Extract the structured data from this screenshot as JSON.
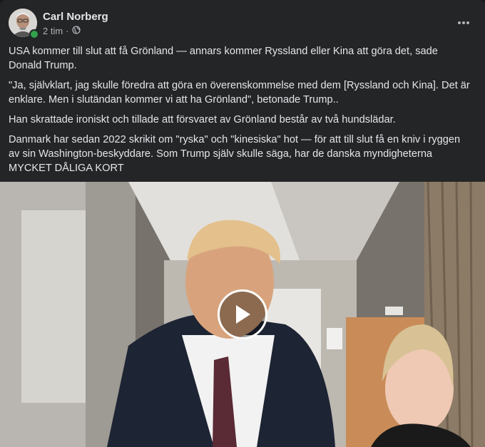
{
  "post": {
    "author": "Carl Norberg",
    "time": "2 tim",
    "privacy_icon": "globe-icon",
    "more_icon": "more-options-icon",
    "paragraphs": [
      "USA kommer till slut att få Grönland — annars kommer Ryssland eller Kina att göra det, sade Donald Trump.",
      "\"Ja, självklart, jag skulle föredra att göra en överenskommelse med dem [Ryssland och Kina]. Det är enklare. Men i slutändan kommer vi att ha Grönland\", betonade Trump..",
      "Han skrattade ironiskt och tillade att försvaret av Grönland består av två hundslädar.",
      "Danmark har sedan 2022 skrikit om \"ryska\" och \"kinesiska\" hot — för att till slut få en kniv i ryggen av sin Washington-beskyddare. Som Trump själv skulle säga, har de danska myndigheterna MYCKET DÅLIGA KORT"
    ]
  },
  "video": {
    "play_icon": "play-icon"
  },
  "colors": {
    "background": "#242526",
    "text": "#e4e6eb",
    "secondary_text": "#b0b3b8",
    "online": "#31a24c"
  }
}
